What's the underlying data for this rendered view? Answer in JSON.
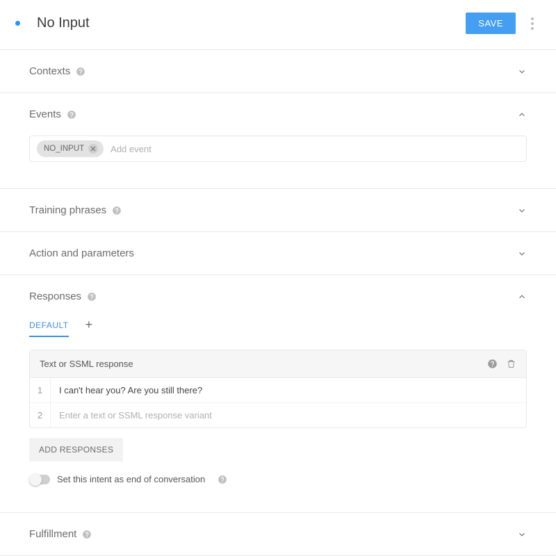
{
  "header": {
    "title": "No Input",
    "save_label": "SAVE"
  },
  "sections": {
    "contexts": {
      "title": "Contexts"
    },
    "events": {
      "title": "Events",
      "chips": [
        "NO_INPUT"
      ],
      "add_placeholder": "Add event"
    },
    "training": {
      "title": "Training phrases"
    },
    "action": {
      "title": "Action and parameters"
    },
    "responses": {
      "title": "Responses",
      "tabs": {
        "default_label": "DEFAULT"
      },
      "card_title": "Text or SSML response",
      "rows": [
        {
          "idx": "1",
          "value": "I can't hear you? Are you still there?"
        },
        {
          "idx": "2",
          "value": "",
          "placeholder": "Enter a text or SSML response variant"
        }
      ],
      "add_button": "ADD RESPONSES",
      "end_conv_label": "Set this intent as end of conversation",
      "end_conv_on": false
    },
    "fulfillment": {
      "title": "Fulfillment"
    }
  }
}
